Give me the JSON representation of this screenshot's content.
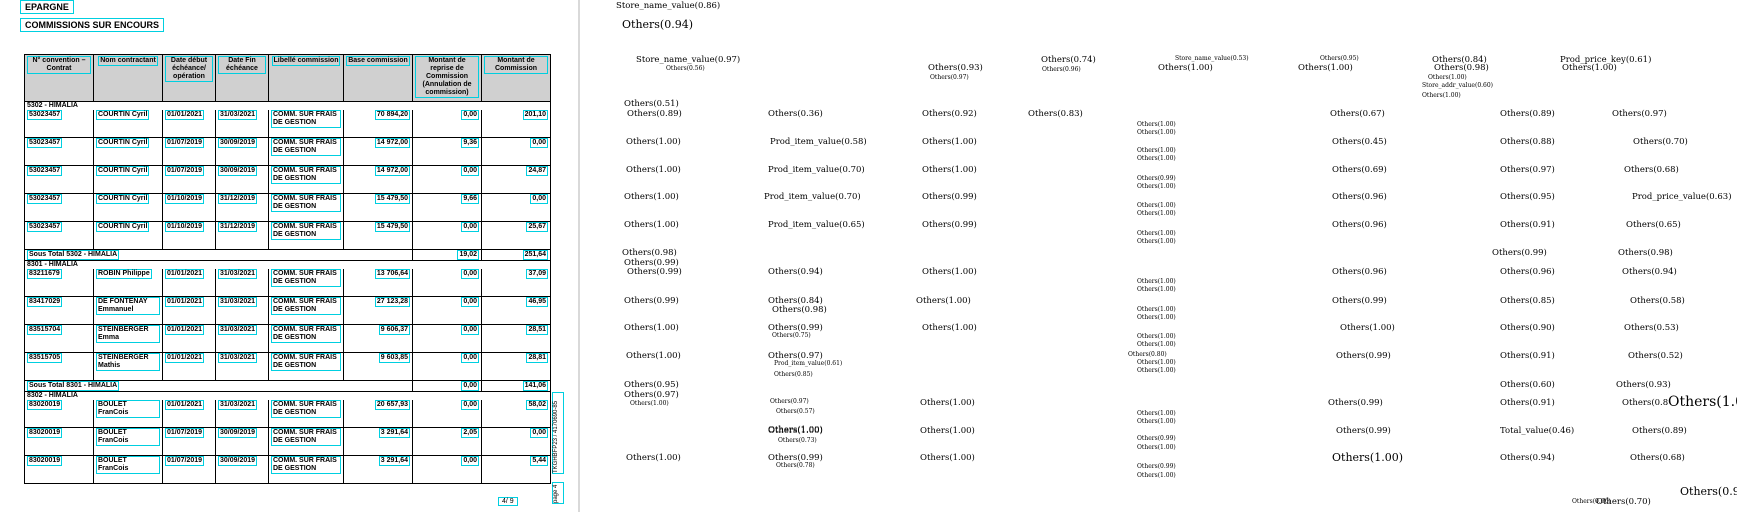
{
  "document": {
    "title": "EPARGNE",
    "subtitle": "COMMISSIONS SUR ENCOURS",
    "headers": [
      "N° convention – Contrat",
      "Nom contractant",
      "Date début échéance/ opération",
      "Date Fin échéance",
      "Libellé commission",
      "Base commission",
      "Montant de reprise de Commission (Annulation de commission)",
      "Montant de Commission"
    ],
    "groups": [
      {
        "name": "5302 - HIMALIA",
        "rows": [
          [
            "53023457",
            "COURTIN Cyril",
            "01/01/2021",
            "31/03/2021",
            "COMM. SUR FRAIS DE GESTION",
            "70 894,20",
            "0,00",
            "201,10"
          ],
          [
            "53023457",
            "COURTIN Cyril",
            "01/07/2019",
            "30/09/2019",
            "COMM. SUR FRAIS DE GESTION",
            "14 972,00",
            "9,36",
            "0,00"
          ],
          [
            "53023457",
            "COURTIN Cyril",
            "01/07/2019",
            "30/09/2019",
            "COMM. SUR FRAIS DE GESTION",
            "14 972,00",
            "0,00",
            "24,87"
          ],
          [
            "53023457",
            "COURTIN Cyril",
            "01/10/2019",
            "31/12/2019",
            "COMM. SUR FRAIS DE GESTION",
            "15 479,50",
            "9,66",
            "0,00"
          ],
          [
            "53023457",
            "COURTIN Cyril",
            "01/10/2019",
            "31/12/2019",
            "COMM. SUR FRAIS DE GESTION",
            "15 479,50",
            "0,00",
            "25,67"
          ]
        ],
        "subtotal_label": "Sous Total 5302 - HIMALIA",
        "subtotal_reprise": "19,02",
        "subtotal_commission": "251,64"
      },
      {
        "name": "8301 - HIMALIA",
        "rows": [
          [
            "83211679",
            "ROBIN Philippe",
            "01/01/2021",
            "31/03/2021",
            "COMM. SUR FRAIS DE GESTION",
            "13 706,64",
            "0,00",
            "37,09"
          ],
          [
            "83417029",
            "DE FONTENAY Emmanuel",
            "01/01/2021",
            "31/03/2021",
            "COMM. SUR FRAIS DE GESTION",
            "27 123,28",
            "0,00",
            "46,95"
          ],
          [
            "83515704",
            "STEINBERGER Emma",
            "01/01/2021",
            "31/03/2021",
            "COMM. SUR FRAIS DE GESTION",
            "9 606,37",
            "0,00",
            "28,51"
          ],
          [
            "83515705",
            "STEINBERGER Mathis",
            "01/01/2021",
            "31/03/2021",
            "COMM. SUR FRAIS DE GESTION",
            "9 603,85",
            "0,00",
            "28,81"
          ]
        ],
        "subtotal_label": "Sous Total 8301 - HIMALIA",
        "subtotal_reprise": "0,00",
        "subtotal_commission": "141,06"
      },
      {
        "name": "8302 - HIMALIA",
        "rows": [
          [
            "83020019",
            "BOULET FranCois",
            "01/01/2021",
            "31/03/2021",
            "COMM. SUR FRAIS DE GESTION",
            "20 657,93",
            "0,00",
            "58,02"
          ],
          [
            "83020019",
            "BOULET FranCois",
            "01/07/2019",
            "30/09/2019",
            "COMM. SUR FRAIS DE GESTION",
            "3 291,64",
            "2,05",
            "0,00"
          ],
          [
            "83020019",
            "BOULET FranCois",
            "01/07/2019",
            "30/09/2019",
            "COMM. SUR FRAIS DE GESTION",
            "3 291,64",
            "0,00",
            "5,44"
          ]
        ]
      }
    ],
    "page_number": "4/ 9",
    "side_code": "TKGHBFP23 / 4170690-85",
    "side_code_2": "page 4"
  },
  "predictions": [
    {
      "text": "Store_name_value(0.86)",
      "size": "m"
    },
    {
      "text": "Others(0.94)",
      "size": "l"
    },
    {
      "text": "Store_name_value(0.97)",
      "size": "m"
    },
    {
      "text": "Others(0.56)",
      "size": "s"
    },
    {
      "text": "Others(0.93)",
      "size": "m"
    },
    {
      "text": "Others(0.97)",
      "size": "s"
    },
    {
      "text": "Others(0.74)",
      "size": "m"
    },
    {
      "text": "Others(0.96)",
      "size": "s"
    },
    {
      "text": "Store_name_value(0.53)",
      "size": "s"
    },
    {
      "text": "Others(1.00)",
      "size": "m"
    },
    {
      "text": "Others(0.95)",
      "size": "s"
    },
    {
      "text": "Others(1.00)",
      "size": "m"
    },
    {
      "text": "Others(0.84)",
      "size": "m"
    },
    {
      "text": "Others(0.98)",
      "size": "m"
    },
    {
      "text": "Others(1.00)",
      "size": "s"
    },
    {
      "text": "Store_addr_value(0.60)",
      "size": "s"
    },
    {
      "text": "Others(1.00)",
      "size": "s"
    },
    {
      "text": "Prod_price_key(0.61)",
      "size": "m"
    },
    {
      "text": "Others(1.00)",
      "size": "m"
    },
    {
      "text": "Others(0.51)",
      "size": "m"
    },
    {
      "text": "Others(0.89)",
      "size": "m"
    },
    {
      "text": "Others(0.36)",
      "size": "m"
    },
    {
      "text": "Others(0.92)",
      "size": "m"
    },
    {
      "text": "Others(0.83)",
      "size": "m"
    },
    {
      "text": "Others(1.00)",
      "size": "s"
    },
    {
      "text": "Others(1.00)",
      "size": "s"
    },
    {
      "text": "Others(0.67)",
      "size": "m"
    },
    {
      "text": "Others(0.89)",
      "size": "m"
    },
    {
      "text": "Others(0.97)",
      "size": "m"
    },
    {
      "text": "Others(1.00)",
      "size": "m"
    },
    {
      "text": "Prod_item_value(0.58)",
      "size": "m"
    },
    {
      "text": "Others(1.00)",
      "size": "m"
    },
    {
      "text": "Others(1.00)",
      "size": "s"
    },
    {
      "text": "Others(1.00)",
      "size": "s"
    },
    {
      "text": "Others(0.45)",
      "size": "m"
    },
    {
      "text": "Others(0.88)",
      "size": "m"
    },
    {
      "text": "Others(0.70)",
      "size": "m"
    },
    {
      "text": "Others(1.00)",
      "size": "m"
    },
    {
      "text": "Prod_item_value(0.70)",
      "size": "m"
    },
    {
      "text": "Others(1.00)",
      "size": "m"
    },
    {
      "text": "Others(0.99)",
      "size": "s"
    },
    {
      "text": "Others(1.00)",
      "size": "s"
    },
    {
      "text": "Others(0.69)",
      "size": "m"
    },
    {
      "text": "Others(0.97)",
      "size": "m"
    },
    {
      "text": "Others(0.68)",
      "size": "m"
    },
    {
      "text": "Others(1.00)",
      "size": "m"
    },
    {
      "text": "Prod_item_value(0.70)",
      "size": "m"
    },
    {
      "text": "Others(0.99)",
      "size": "m"
    },
    {
      "text": "Others(1.00)",
      "size": "s"
    },
    {
      "text": "Others(1.00)",
      "size": "s"
    },
    {
      "text": "Others(0.96)",
      "size": "m"
    },
    {
      "text": "Others(0.95)",
      "size": "m"
    },
    {
      "text": "Prod_price_value(0.63)",
      "size": "m"
    },
    {
      "text": "Others(1.00)",
      "size": "m"
    },
    {
      "text": "Prod_item_value(0.65)",
      "size": "m"
    },
    {
      "text": "Others(0.99)",
      "size": "m"
    },
    {
      "text": "Others(1.00)",
      "size": "s"
    },
    {
      "text": "Others(1.00)",
      "size": "s"
    },
    {
      "text": "Others(0.96)",
      "size": "m"
    },
    {
      "text": "Others(0.91)",
      "size": "m"
    },
    {
      "text": "Others(0.65)",
      "size": "m"
    },
    {
      "text": "Others(0.98)",
      "size": "m"
    },
    {
      "text": "Others(0.99)",
      "size": "m"
    },
    {
      "text": "Others(0.99)",
      "size": "m"
    },
    {
      "text": "Others(0.98)",
      "size": "m"
    },
    {
      "text": "Others(0.99)",
      "size": "m"
    },
    {
      "text": "Others(0.94)",
      "size": "m"
    },
    {
      "text": "Others(1.00)",
      "size": "m"
    },
    {
      "text": "Others(1.00)",
      "size": "s"
    },
    {
      "text": "Others(1.00)",
      "size": "s"
    },
    {
      "text": "Others(0.96)",
      "size": "m"
    },
    {
      "text": "Others(0.96)",
      "size": "m"
    },
    {
      "text": "Others(0.94)",
      "size": "m"
    },
    {
      "text": "Others(0.99)",
      "size": "m"
    },
    {
      "text": "Others(0.84)",
      "size": "m"
    },
    {
      "text": "Others(0.98)",
      "size": "m"
    },
    {
      "text": "Others(1.00)",
      "size": "m"
    },
    {
      "text": "Others(1.00)",
      "size": "s"
    },
    {
      "text": "Others(1.00)",
      "size": "s"
    },
    {
      "text": "Others(0.99)",
      "size": "m"
    },
    {
      "text": "Others(0.85)",
      "size": "m"
    },
    {
      "text": "Others(0.58)",
      "size": "m"
    },
    {
      "text": "Others(1.00)",
      "size": "m"
    },
    {
      "text": "Others(0.99)",
      "size": "m"
    },
    {
      "text": "Others(0.75)",
      "size": "s"
    },
    {
      "text": "Others(1.00)",
      "size": "m"
    },
    {
      "text": "Others(1.00)",
      "size": "s"
    },
    {
      "text": "Others(1.00)",
      "size": "s"
    },
    {
      "text": "Others(1.00)",
      "size": "m"
    },
    {
      "text": "Others(0.90)",
      "size": "m"
    },
    {
      "text": "Others(0.53)",
      "size": "m"
    },
    {
      "text": "Others(1.00)",
      "size": "m"
    },
    {
      "text": "Others(0.97)",
      "size": "m"
    },
    {
      "text": "Prod_item_value(0.61)",
      "size": "s"
    },
    {
      "text": "Others(0.85)",
      "size": "s"
    },
    {
      "text": "Others(0.80)",
      "size": "s"
    },
    {
      "text": "Others(1.00)",
      "size": "s"
    },
    {
      "text": "Others(1.00)",
      "size": "s"
    },
    {
      "text": "Others(0.99)",
      "size": "m"
    },
    {
      "text": "Others(0.91)",
      "size": "m"
    },
    {
      "text": "Others(0.52)",
      "size": "m"
    },
    {
      "text": "Others(0.95)",
      "size": "m"
    },
    {
      "text": "Others(0.97)",
      "size": "m"
    },
    {
      "text": "Others(0.60)",
      "size": "m"
    },
    {
      "text": "Others(0.93)",
      "size": "m"
    },
    {
      "text": "Others(1.00)",
      "size": "s"
    },
    {
      "text": "Others(0.97)",
      "size": "s"
    },
    {
      "text": "Others(0.57)",
      "size": "s"
    },
    {
      "text": "Others(1.00)",
      "size": "m"
    },
    {
      "text": "Others(1.00)",
      "size": "s"
    },
    {
      "text": "Others(1.00)",
      "size": "s"
    },
    {
      "text": "Others(0.99)",
      "size": "m"
    },
    {
      "text": "Others(0.91)",
      "size": "m"
    },
    {
      "text": "Others(0.8",
      "size": "m"
    },
    {
      "text": "Others(1.0",
      "size": "xl"
    },
    {
      "text": "Others(1.00)",
      "size": "m"
    },
    {
      "text": "Others(1.00)",
      "size": "m"
    },
    {
      "text": "Others(0.73)",
      "size": "s"
    },
    {
      "text": "Others(1.00)",
      "size": "m"
    },
    {
      "text": "Others(0.99)",
      "size": "s"
    },
    {
      "text": "Others(1.00)",
      "size": "s"
    },
    {
      "text": "Others(0.99)",
      "size": "m"
    },
    {
      "text": "Total_value(0.46)",
      "size": "m"
    },
    {
      "text": "Others(0.89)",
      "size": "m"
    },
    {
      "text": "Others(1.00)",
      "size": "m"
    },
    {
      "text": "Others(0.99)",
      "size": "m"
    },
    {
      "text": "Others(0.78)",
      "size": "s"
    },
    {
      "text": "Others(1.00)",
      "size": "m"
    },
    {
      "text": "Others(0.99)",
      "size": "s"
    },
    {
      "text": "Others(1.00)",
      "size": "s"
    },
    {
      "text": "Others(1.00)",
      "size": "l"
    },
    {
      "text": "Others(0.94)",
      "size": "m"
    },
    {
      "text": "Others(0.68)",
      "size": "m"
    },
    {
      "text": "Others(0.9",
      "size": "l"
    },
    {
      "text": "Others(0.66)",
      "size": "s"
    },
    {
      "text": "Others(0.70)",
      "size": "m"
    }
  ]
}
